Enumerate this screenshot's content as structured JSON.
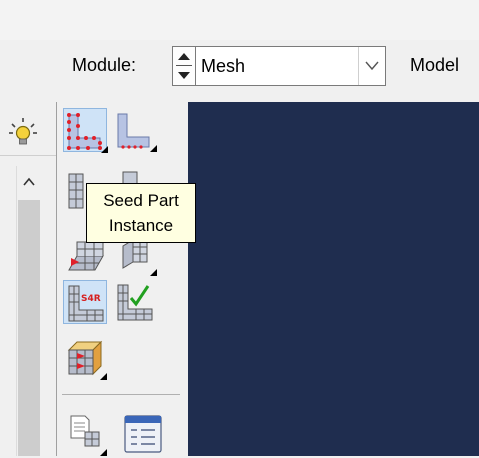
{
  "toolbar": {
    "module_label": "Module:",
    "module_value": "Mesh",
    "model_label": "Model"
  },
  "tooltip": {
    "line1": "Seed Part",
    "line2": "Instance"
  },
  "icons": {
    "bulb": "lightbulb-icon",
    "scroll_up": "chevron-up-icon",
    "seed_part_instance": "seed-part-instance-icon",
    "seed_edges": "seed-edges-icon",
    "mesh_part_instance": "mesh-part-instance-icon",
    "mesh_region": "mesh-region-icon",
    "mesh_controls": "mesh-controls-icon",
    "element_type": "element-type-icon",
    "verify_mesh": "verify-mesh-icon",
    "create_mesh_part": "create-mesh-part-icon",
    "query": "query-icon",
    "table": "table-icon"
  },
  "colors": {
    "viewport": "#1f2d4f",
    "tooltip_bg": "#ffffe1",
    "selected_tool": "#cfe3f7",
    "seed_red": "#e0202a",
    "mesh_blue": "#a7b3d6"
  }
}
